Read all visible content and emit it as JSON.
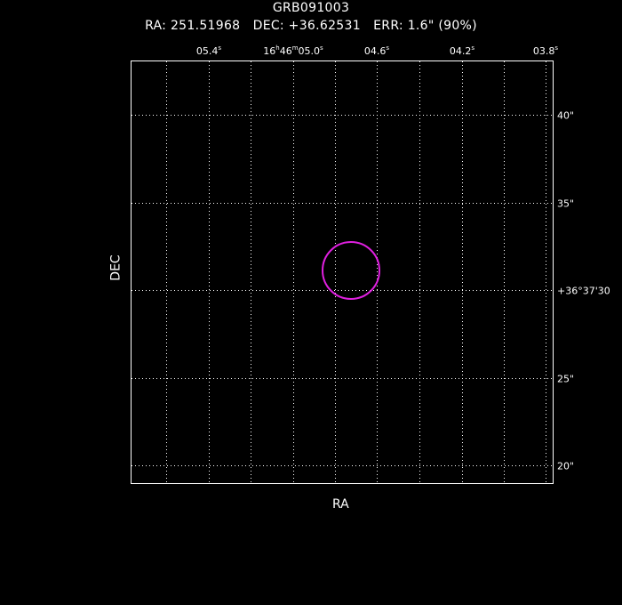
{
  "header": {
    "grb_name": "GRB091003",
    "coords_line": "RA: 251.51968   DEC: +36.62531   ERR: 1.6\" (90%)"
  },
  "axes": {
    "xlabel": "RA",
    "ylabel": "DEC"
  },
  "ra_ticks": [
    {
      "sec": "05.4",
      "label_pre": "",
      "h": "",
      "m": ""
    },
    {
      "sec": "05.0",
      "label_pre": "16",
      "h": "h",
      "m": "46"
    },
    {
      "sec": "04.6",
      "label_pre": "",
      "h": "",
      "m": ""
    },
    {
      "sec": "04.2",
      "label_pre": "",
      "h": "",
      "m": ""
    },
    {
      "sec": "03.8",
      "label_pre": "",
      "h": "",
      "m": ""
    }
  ],
  "dec_ticks": [
    "40\"",
    "35\"",
    "+36°37'30",
    "25\"",
    "20\""
  ],
  "error_circle": {
    "ra_deg": 251.51968,
    "dec_deg": 36.62531,
    "radius_arcsec": 1.6,
    "color": "#e020e0"
  },
  "colors": {
    "background": "#000000",
    "frame": "#ffffff",
    "grid": "#ffffff"
  }
}
